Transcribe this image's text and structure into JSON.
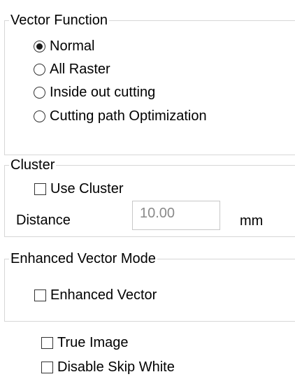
{
  "vector_function": {
    "legend": "Vector Function",
    "options": [
      {
        "label": "Normal",
        "checked": true
      },
      {
        "label": "All Raster",
        "checked": false
      },
      {
        "label": "Inside out cutting",
        "checked": false
      },
      {
        "label": "Cutting path Optimization",
        "checked": false
      }
    ]
  },
  "cluster": {
    "legend": "Cluster",
    "use_cluster_label": "Use Cluster",
    "use_cluster_checked": false,
    "distance_label": "Distance",
    "distance_value": "10.00",
    "distance_enabled": false,
    "unit": "mm"
  },
  "enhanced_vector_mode": {
    "legend": "Enhanced Vector Mode",
    "enhanced_vector_label": "Enhanced Vector",
    "enhanced_vector_checked": false
  },
  "true_image": {
    "label": "True Image",
    "checked": false
  },
  "disable_skip_white": {
    "label": "Disable Skip White",
    "checked": false
  }
}
